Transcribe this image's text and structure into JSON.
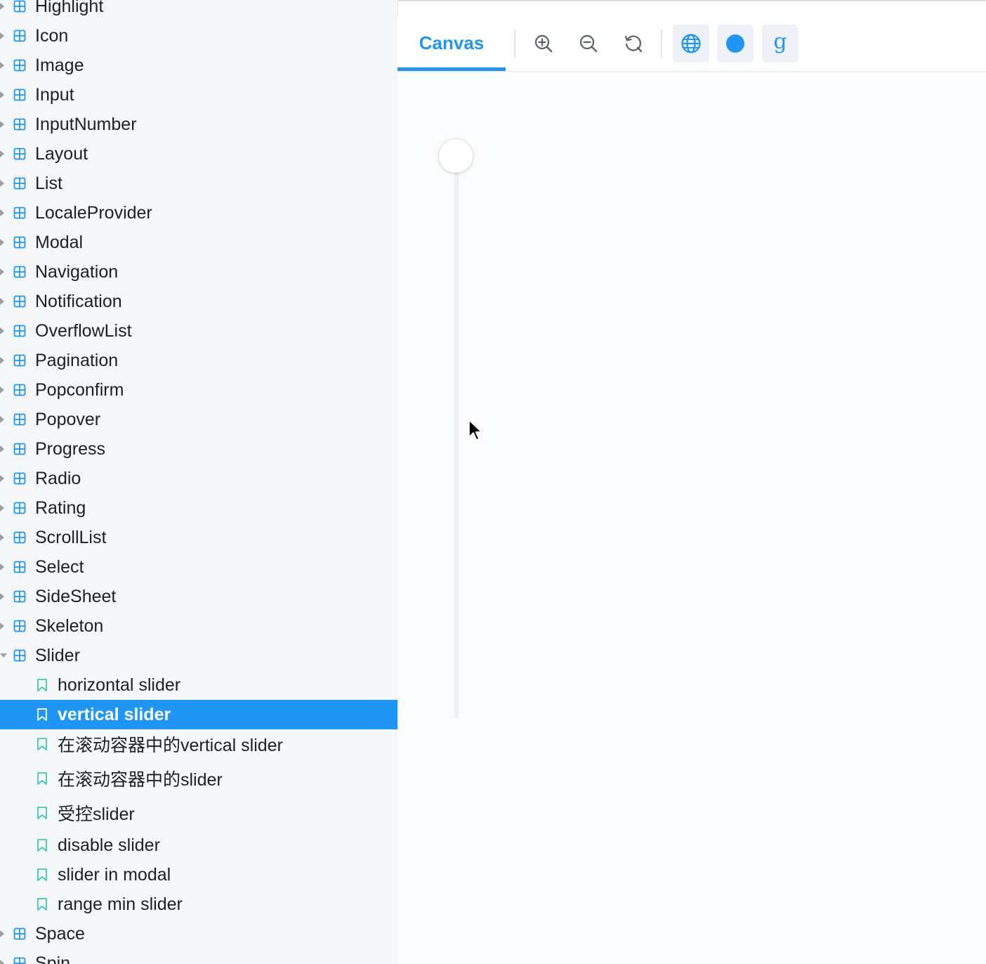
{
  "sidebar": {
    "items": [
      {
        "label": "Highlight",
        "type": "group",
        "open": false
      },
      {
        "label": "Icon",
        "type": "group",
        "open": false
      },
      {
        "label": "Image",
        "type": "group",
        "open": false
      },
      {
        "label": "Input",
        "type": "group",
        "open": false
      },
      {
        "label": "InputNumber",
        "type": "group",
        "open": false
      },
      {
        "label": "Layout",
        "type": "group",
        "open": false
      },
      {
        "label": "List",
        "type": "group",
        "open": false
      },
      {
        "label": "LocaleProvider",
        "type": "group",
        "open": false
      },
      {
        "label": "Modal",
        "type": "group",
        "open": false
      },
      {
        "label": "Navigation",
        "type": "group",
        "open": false
      },
      {
        "label": "Notification",
        "type": "group",
        "open": false
      },
      {
        "label": "OverflowList",
        "type": "group",
        "open": false
      },
      {
        "label": "Pagination",
        "type": "group",
        "open": false
      },
      {
        "label": "Popconfirm",
        "type": "group",
        "open": false
      },
      {
        "label": "Popover",
        "type": "group",
        "open": false
      },
      {
        "label": "Progress",
        "type": "group",
        "open": false
      },
      {
        "label": "Radio",
        "type": "group",
        "open": false
      },
      {
        "label": "Rating",
        "type": "group",
        "open": false
      },
      {
        "label": "ScrollList",
        "type": "group",
        "open": false
      },
      {
        "label": "Select",
        "type": "group",
        "open": false
      },
      {
        "label": "SideSheet",
        "type": "group",
        "open": false
      },
      {
        "label": "Skeleton",
        "type": "group",
        "open": false
      },
      {
        "label": "Slider",
        "type": "group",
        "open": true
      },
      {
        "label": "horizontal slider",
        "type": "story",
        "selected": false
      },
      {
        "label": "vertical slider",
        "type": "story",
        "selected": true
      },
      {
        "label": "在滚动容器中的vertical slider",
        "type": "story",
        "selected": false
      },
      {
        "label": "在滚动容器中的slider",
        "type": "story",
        "selected": false
      },
      {
        "label": "受控slider",
        "type": "story",
        "selected": false
      },
      {
        "label": "disable slider",
        "type": "story",
        "selected": false
      },
      {
        "label": "slider in modal",
        "type": "story",
        "selected": false
      },
      {
        "label": "range min slider",
        "type": "story",
        "selected": false
      },
      {
        "label": "Space",
        "type": "group",
        "open": false
      },
      {
        "label": "Spin",
        "type": "group",
        "open": false
      }
    ]
  },
  "toolbar": {
    "tab_canvas": "Canvas",
    "buttons": [
      {
        "name": "zoom-in-icon"
      },
      {
        "name": "zoom-out-icon"
      },
      {
        "name": "reset-zoom-icon"
      },
      {
        "name": "globe-icon"
      },
      {
        "name": "circle-icon"
      },
      {
        "name": "g-icon",
        "glyph": "g"
      }
    ]
  },
  "canvas": {
    "slider": {
      "orientation": "vertical",
      "value": 0
    }
  },
  "colors": {
    "accent": "#1f96f5",
    "sidebar_bg": "#f6f7f9",
    "bookmark_icon": "#3ec7b9"
  }
}
